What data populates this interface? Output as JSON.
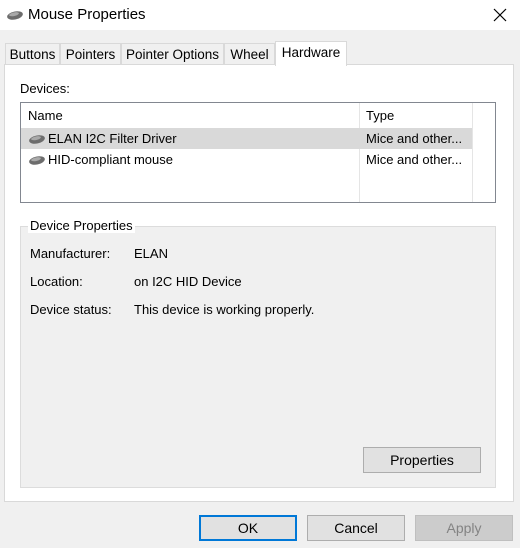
{
  "window": {
    "title": "Mouse Properties",
    "icon": "mouse-icon"
  },
  "tabs": [
    {
      "label": "Buttons",
      "active": false
    },
    {
      "label": "Pointers",
      "active": false
    },
    {
      "label": "Pointer Options",
      "active": false
    },
    {
      "label": "Wheel",
      "active": false
    },
    {
      "label": "Hardware",
      "active": true
    }
  ],
  "devices": {
    "label": "Devices:",
    "columns": [
      "Name",
      "Type"
    ],
    "rows": [
      {
        "name": "ELAN I2C Filter Driver",
        "type": "Mice and other...",
        "selected": true,
        "icon": "mouse-device-icon"
      },
      {
        "name": "HID-compliant mouse",
        "type": "Mice and other...",
        "selected": false,
        "icon": "mouse-device-icon"
      }
    ]
  },
  "device_properties": {
    "title": "Device Properties",
    "fields": [
      {
        "label": "Manufacturer:",
        "value": "ELAN"
      },
      {
        "label": "Location:",
        "value": "on I2C HID Device"
      },
      {
        "label": "Device status:",
        "value": "This device is working properly."
      }
    ],
    "properties_button": "Properties"
  },
  "footer": {
    "ok": "OK",
    "cancel": "Cancel",
    "apply": "Apply"
  },
  "colors": {
    "accent": "#0078d7",
    "selected_row": "#d9d9d9",
    "dialog_bg": "#f0f0f0"
  }
}
